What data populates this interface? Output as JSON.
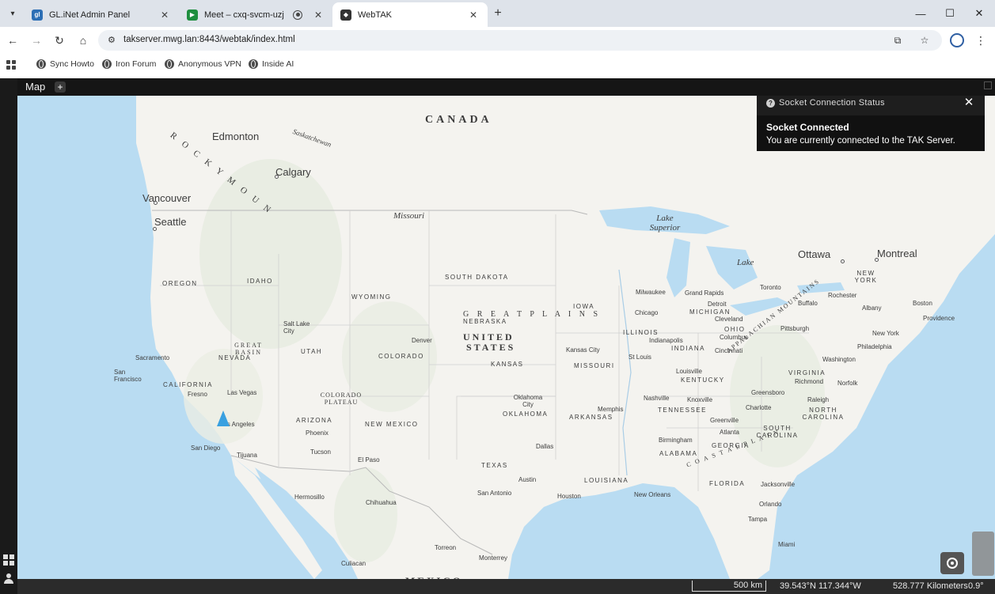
{
  "browser": {
    "tabs": [
      {
        "label": "GL.iNet Admin Panel",
        "favicon": "glinet-icon",
        "color": "#2d6fb5"
      },
      {
        "label": "Meet – cxq-svcm-uzj",
        "favicon": "meet-icon",
        "color": "#1e8e3e"
      },
      {
        "label": "WebTAK",
        "favicon": "webtak-icon",
        "color": "#333333"
      }
    ],
    "url": "takserver.mwg.lan:8443/webtak/index.html",
    "bookmarks": [
      "Sync Howto",
      "Iron Forum",
      "Anonymous VPN",
      "Inside AI"
    ]
  },
  "app": {
    "panel_title": "Map",
    "notification": {
      "title": "Socket Connection Status",
      "heading": "Socket Connected",
      "message": "You are currently connected to the TAK Server.",
      "accent": "#35c96a"
    },
    "status": {
      "scale": "500 km",
      "coordinates": "39.543°N 117.344°W",
      "distance": "528.777 Kilometers",
      "heading": "0.9°"
    }
  },
  "map": {
    "countries": [
      "CANADA",
      "UNITED",
      "STATES",
      "MEXICO"
    ],
    "cities": {
      "edmonton": "Edmonton",
      "calgary": "Calgary",
      "vancouver": "Vancouver",
      "seattle": "Seattle",
      "ottawa": "Ottawa",
      "montreal": "Montreal",
      "toronto": "Toronto",
      "boston": "Boston",
      "new_york": "New York",
      "philadelphia": "Philadelphia",
      "washington": "Washington",
      "chicago": "Chicago",
      "milwaukee": "Milwaukee",
      "detroit": "Detroit",
      "cleveland": "Cleveland",
      "columbus": "Columbus",
      "pittsburgh": "Pittsburgh",
      "buffalo": "Buffalo",
      "rochester": "Rochester",
      "albany": "Albany",
      "providence": "Providence",
      "indianapolis": "Indianapolis",
      "cincinnati": "Cincinnati",
      "louisville": "Louisville",
      "st_louis": "St Louis",
      "kansas_city": "Kansas City",
      "denver": "Denver",
      "salt_lake_city": "Salt Lake City",
      "las_vegas": "Las Vegas",
      "los_angeles": "Los Angeles",
      "san_diego": "San Diego",
      "tijuana": "Tijuana",
      "sacramento": "Sacramento",
      "san_francisco": "San Francisco",
      "fresno": "Fresno",
      "phoenix": "Phoenix",
      "tucson": "Tucson",
      "el_paso": "El Paso",
      "dallas": "Dallas",
      "austin": "Austin",
      "san_antonio": "San Antonio",
      "houston": "Houston",
      "new_orleans": "New Orleans",
      "memphis": "Memphis",
      "nashville": "Nashville",
      "knoxville": "Knoxville",
      "atlanta": "Atlanta",
      "birmingham": "Birmingham",
      "charlotte": "Charlotte",
      "greenville": "Greenville",
      "greensboro": "Greensboro",
      "raleigh": "Raleigh",
      "richmond": "Richmond",
      "norfolk": "Norfolk",
      "jacksonville": "Jacksonville",
      "orlando": "Orlando",
      "tampa": "Tampa",
      "miami": "Miami",
      "oklahoma_city": "Oklahoma City",
      "grand_rapids": "Grand Rapids",
      "hermosillo": "Hermosillo",
      "chihuahua": "Chihuahua",
      "monterrey": "Monterrey",
      "torreon": "Torreon",
      "culiacan": "Culiacan"
    },
    "states": {
      "oregon": "OREGON",
      "idaho": "IDAHO",
      "wyoming": "WYOMING",
      "south_dakota": "SOUTH DAKOTA",
      "nebraska": "NEBRASKA",
      "iowa": "IOWA",
      "nevada": "NEVADA",
      "utah": "UTAH",
      "colorado": "COLORADO",
      "kansas": "KANSAS",
      "missouri": "MISSOURI",
      "illinois": "ILLINOIS",
      "indiana": "INDIANA",
      "ohio": "OHIO",
      "michigan": "MICHIGAN",
      "california": "CALIFORNIA",
      "arizona": "ARIZONA",
      "new_mexico": "NEW MEXICO",
      "oklahoma": "OKLAHOMA",
      "texas": "TEXAS",
      "arkansas": "ARKANSAS",
      "louisiana": "LOUISIANA",
      "tennessee": "TENNESSEE",
      "kentucky": "KENTUCKY",
      "virginia": "VIRGINIA",
      "north_carolina": "NORTH\nCAROLINA",
      "south_carolina": "SOUTH\nCAROLINA",
      "georgia": "GEORGIA",
      "alabama": "ALABAMA",
      "florida": "FLORIDA",
      "new_york_state": "NEW\nYORK"
    },
    "regions": {
      "rocky": "R O C K Y   M O U N",
      "great_plains": "G R E A T   P L A I N S",
      "great_basin": "GREAT\nBASIN",
      "colorado_plateau": "COLORADO\nPLATEAU",
      "appalachian": "APPALACHIAN MOUNTAINS",
      "coastal_plain": "C O A S T A L   P L A I N"
    },
    "water": {
      "lake_superior": "Lake\nSuperior",
      "lake": "Lake",
      "missouri_river": "Missouri",
      "saskatchewan": "Saskatchewan"
    }
  }
}
